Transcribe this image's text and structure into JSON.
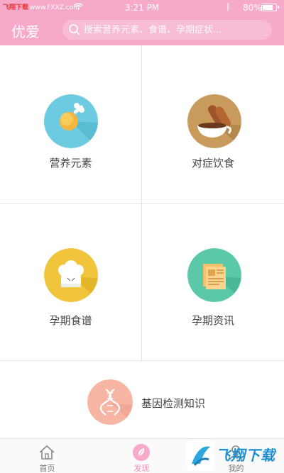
{
  "status_bar": {
    "watermark": "飞翔下载",
    "watermark_url": "www.FXXZ.com",
    "time": "3:21 PM",
    "battery": "80%",
    "battery_level": 0.8
  },
  "header": {
    "title": "优爱",
    "search_placeholder": "搜索营养元素、食谱、孕期症状..."
  },
  "categories": [
    {
      "label": "营养元素",
      "icon": "chicken-leg-icon",
      "color": "#6ccbe0"
    },
    {
      "label": "对症饮食",
      "icon": "bread-soup-icon",
      "color": "#c89a5b"
    },
    {
      "label": "孕期食谱",
      "icon": "chef-hat-icon",
      "color": "#f0c43b"
    },
    {
      "label": "孕期资讯",
      "icon": "news-icon",
      "color": "#5bc8a8"
    },
    {
      "label": "基因检测知识",
      "icon": "dna-icon",
      "color": "#f7b5a3"
    }
  ],
  "tabs": [
    {
      "label": "首页",
      "icon": "home-icon"
    },
    {
      "label": "发现",
      "icon": "leaf-icon"
    },
    {
      "label": "我的",
      "icon": "user-icon"
    }
  ],
  "active_tab": "发现",
  "bottom_watermark": "飞翔下载"
}
